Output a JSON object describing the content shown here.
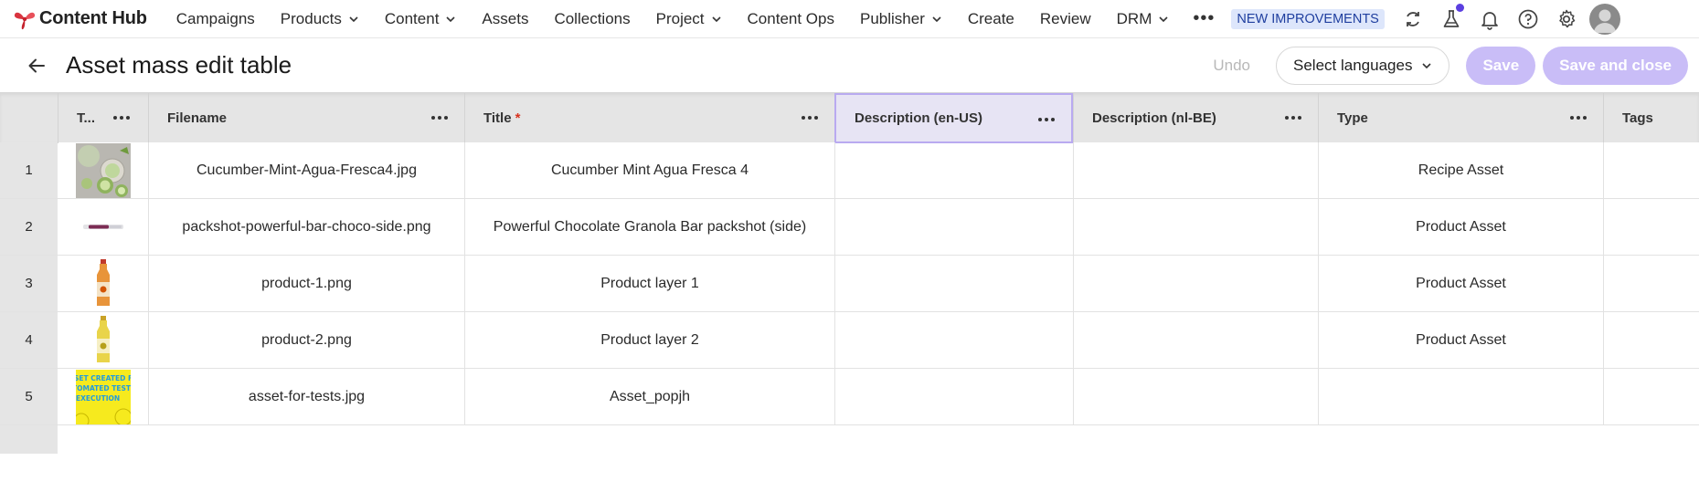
{
  "nav": {
    "brand": "Content Hub",
    "items": [
      {
        "label": "Campaigns",
        "dropdown": false
      },
      {
        "label": "Products",
        "dropdown": true
      },
      {
        "label": "Content",
        "dropdown": true
      },
      {
        "label": "Assets",
        "dropdown": false
      },
      {
        "label": "Collections",
        "dropdown": false
      },
      {
        "label": "Project",
        "dropdown": true
      },
      {
        "label": "Content Ops",
        "dropdown": false
      },
      {
        "label": "Publisher",
        "dropdown": true
      },
      {
        "label": "Create",
        "dropdown": false
      },
      {
        "label": "Review",
        "dropdown": false
      },
      {
        "label": "DRM",
        "dropdown": true
      }
    ],
    "more": "•••",
    "badge": "NEW IMPROVEMENTS",
    "icons": [
      "refresh-icon",
      "flask-icon",
      "bell-icon",
      "help-icon",
      "gear-icon",
      "avatar"
    ]
  },
  "header": {
    "title": "Asset mass edit table",
    "undo": "Undo",
    "language_select": "Select languages",
    "save": "Save",
    "save_close": "Save and close"
  },
  "table": {
    "columns": [
      {
        "label": "T...",
        "required": false
      },
      {
        "label": "Filename",
        "required": false
      },
      {
        "label": "Title",
        "required": true,
        "required_mark": "*"
      },
      {
        "label": "Description (en-US)",
        "required": false,
        "selected": true
      },
      {
        "label": "Description (nl-BE)",
        "required": false
      },
      {
        "label": "Type",
        "required": false
      },
      {
        "label": "Tags",
        "required": false
      }
    ],
    "rows": [
      {
        "num": "1",
        "thumb": "cucumber-drink",
        "filename": "Cucumber-Mint-Agua-Fresca4.jpg",
        "title": "Cucumber Mint Agua Fresca 4",
        "desc_en": "",
        "desc_nl": "",
        "type": "Recipe Asset",
        "tags": ""
      },
      {
        "num": "2",
        "thumb": "granola-bar",
        "filename": "packshot-powerful-bar-choco-side.png",
        "title": "Powerful Chocolate Granola Bar packshot (side)",
        "desc_en": "",
        "desc_nl": "",
        "type": "Product Asset",
        "tags": ""
      },
      {
        "num": "3",
        "thumb": "orange-bottle",
        "filename": "product-1.png",
        "title": "Product layer 1",
        "desc_en": "",
        "desc_nl": "",
        "type": "Product Asset",
        "tags": ""
      },
      {
        "num": "4",
        "thumb": "yellow-bottle",
        "filename": "product-2.png",
        "title": "Product layer 2",
        "desc_en": "",
        "desc_nl": "",
        "type": "Product Asset",
        "tags": ""
      },
      {
        "num": "5",
        "thumb": "test-poster",
        "thumb_text": [
          "SET CREATED FOR",
          "TOMATED TESTS",
          "EXECUTION"
        ],
        "filename": "asset-for-tests.jpg",
        "title": "Asset_popjh",
        "desc_en": "",
        "desc_nl": "",
        "type": "",
        "tags": ""
      }
    ]
  },
  "colors": {
    "accent": "#c9bdf7",
    "badge_bg": "#dde6fb",
    "badge_text": "#1f3f9f",
    "required": "#d8321e",
    "notification": "#5b3fe0",
    "header_bg": "#e5e5e5"
  }
}
